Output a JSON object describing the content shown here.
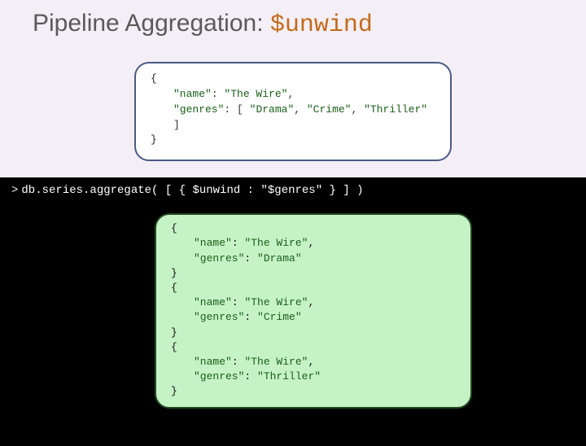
{
  "title": {
    "prefix": "Pipeline Aggregation: ",
    "operator": "$unwind"
  },
  "input_doc": {
    "open_brace": "{",
    "line1_key": "\"name\"",
    "line1_sep": ": ",
    "line1_val": "\"The Wire\"",
    "line1_comma": ",",
    "line2_key": "\"genres\"",
    "line2_sep": ": [ ",
    "line2_v1": "\"Drama\"",
    "line2_c1": ", ",
    "line2_v2": "\"Crime\"",
    "line2_c2": ", ",
    "line2_v3": "\"Thriller\"",
    "line2_close": " ]",
    "close_brace": "}"
  },
  "command": {
    "prompt": ">",
    "text_before": "db.series.aggregate( [ { ",
    "operator": "$unwind",
    "between": " : ",
    "arg": "\"$genres\"",
    "text_after": " } ] )"
  },
  "output_docs": [
    {
      "name_key": "\"name\"",
      "name_val": "\"The Wire\"",
      "genres_key": "\"genres\"",
      "genres_val": "\"Drama\""
    },
    {
      "name_key": "\"name\"",
      "name_val": "\"The Wire\"",
      "genres_key": "\"genres\"",
      "genres_val": "\"Crime\""
    },
    {
      "name_key": "\"name\"",
      "name_val": "\"The Wire\"",
      "genres_key": "\"genres\"",
      "genres_val": "\"Thriller\""
    }
  ],
  "braces": {
    "open": "{",
    "close": "}"
  },
  "sep": {
    "colon": ": ",
    "comma": ","
  }
}
